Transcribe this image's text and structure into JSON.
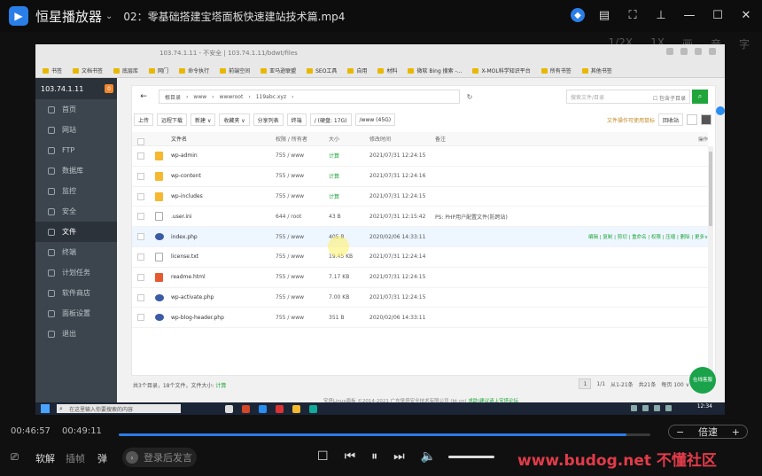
{
  "player": {
    "app_name": "恒星播放器",
    "logo_glyph": "▶",
    "caret": "⌄",
    "video_title": "02：零基础搭建宝塔面板快速建站技术篇.mp4",
    "window_buttons": [
      "shield-icon",
      "subtitle-icon",
      "screenshot-icon",
      "pin-icon",
      "minimize-icon",
      "maximize-icon",
      "close-icon"
    ],
    "side_options": [
      "1/2X",
      "1X",
      "画",
      "音",
      "字"
    ],
    "time_current": "00:46:57",
    "time_total": "00:49:11",
    "progress": 0.955,
    "speed": {
      "minus": "−",
      "label": "倍速",
      "plus": "+"
    },
    "bottom": {
      "danmu_toggle": "弹",
      "hard_decode": "软解",
      "frame": "插帧",
      "danmu_btn": "弹",
      "danmu_placeholder": "登录后发言"
    },
    "watermark": "www.budog.net 不懂社区",
    "accent": "#2a7ee8"
  },
  "browser": {
    "url": "103.74.1.11 - 不安全 | 103.74.1.11/bdwt/files",
    "bookmarks": [
      "书签",
      "文档书签",
      "底层库",
      "网门",
      "命令执行",
      "前端空间",
      "亚马逊联盟",
      "SEO工具",
      "自用",
      "材料",
      "微软 Bing 搜索 -...",
      "X-MOL科学知识平台",
      "所有书签",
      "其他书签"
    ]
  },
  "panel": {
    "server": "103.74.1.11",
    "badge": "0",
    "nav": [
      "首页",
      "网站",
      "FTP",
      "数据库",
      "监控",
      "安全",
      "文件",
      "终端",
      "计划任务",
      "软件商店",
      "面板设置",
      "退出"
    ],
    "active_nav": 6,
    "breadcrumb": [
      "根目录",
      "www",
      "wwwroot",
      "119abc.xyz"
    ],
    "search_placeholder": "搜索文件/目录",
    "search_checkbox": "包含子目录",
    "search_btn": "⌕",
    "toolbar": [
      "上传",
      "远程下载",
      "新建 ∨",
      "收藏夹 ∨",
      "分享列表",
      "终端"
    ],
    "disks": [
      "/ (硬盘: 17G)",
      "/www (45G)"
    ],
    "recycle": "回收站",
    "tip": "文件操作可使用鼠标",
    "columns": {
      "name": "文件名",
      "perm": "权限 / 所有者",
      "size": "大小",
      "time": "修改时间",
      "note": "备注",
      "ops": "操作"
    },
    "files": [
      {
        "name": "wp-admin",
        "type": "folder",
        "perm": "755 / www",
        "size": "计算",
        "time": "2021/07/31 12:24:15",
        "note": ""
      },
      {
        "name": "wp-content",
        "type": "folder",
        "perm": "755 / www",
        "size": "计算",
        "time": "2021/07/31 12:24:16",
        "note": ""
      },
      {
        "name": "wp-includes",
        "type": "folder",
        "perm": "755 / www",
        "size": "计算",
        "time": "2021/07/31 12:24:15",
        "note": ""
      },
      {
        "name": ".user.ini",
        "type": "file",
        "perm": "644 / root",
        "size": "43 B",
        "time": "2021/07/31 12:15:42",
        "note": "PS: PHP用户配置文件(防跨站)"
      },
      {
        "name": "index.php",
        "type": "php",
        "perm": "755 / www",
        "size": "405 B",
        "time": "2020/02/06 14:33:11",
        "note": "",
        "ops": "编辑 | 复制 | 剪切 | 重命名 | 权限 | 压缩 | 删除 | 更多∨"
      },
      {
        "name": "license.txt",
        "type": "file",
        "perm": "755 / www",
        "size": "19.45 KB",
        "time": "2021/07/31 12:24:14",
        "note": ""
      },
      {
        "name": "readme.html",
        "type": "html",
        "perm": "755 / www",
        "size": "7.17 KB",
        "time": "2021/07/31 12:24:15",
        "note": ""
      },
      {
        "name": "wp-activate.php",
        "type": "php",
        "perm": "755 / www",
        "size": "7.00 KB",
        "time": "2021/07/31 12:24:15",
        "note": ""
      },
      {
        "name": "wp-blog-header.php",
        "type": "php",
        "perm": "755 / www",
        "size": "351 B",
        "time": "2020/02/06 14:33:11",
        "note": ""
      }
    ],
    "summary": "共3个目录，18个文件，文件大小:",
    "summary_link": "计算",
    "pager": {
      "cur": "1",
      "total_pages": "1/1",
      "range": "从1-21条",
      "count": "共21条",
      "per_page": "每页 100 ∨"
    },
    "copyright": "宝塔Linux面板 ©2014-2021 广东堡塔安全技术有限公司 (bt.cn)",
    "copyright_link": "求助|建议请上宝塔论坛",
    "online": "在线客服"
  },
  "taskbar": {
    "search_placeholder": "在这里输入你要搜索的内容",
    "clock": "12:34"
  }
}
